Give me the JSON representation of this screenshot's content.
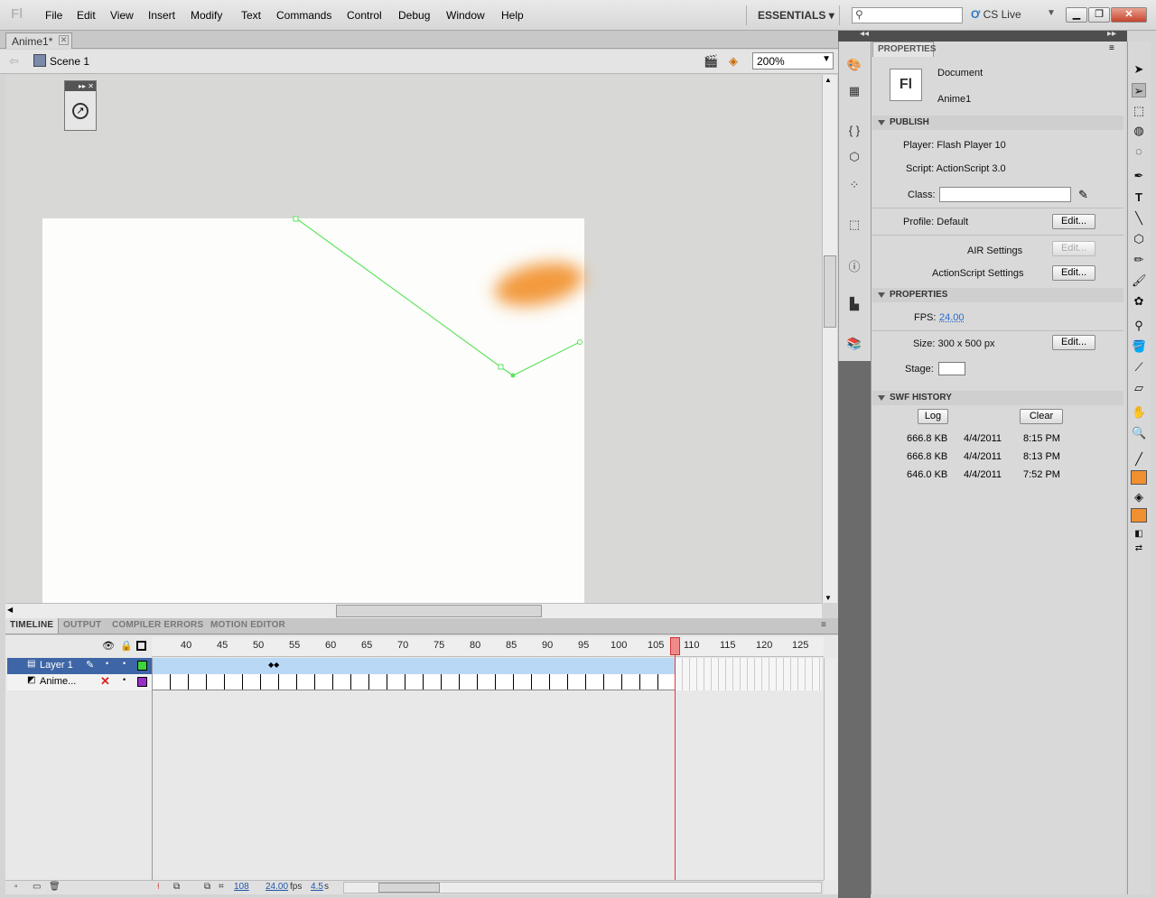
{
  "app": {
    "logo": "Fl"
  },
  "menu": [
    "File",
    "Edit",
    "View",
    "Insert",
    "Modify",
    "Text",
    "Commands",
    "Control",
    "Debug",
    "Window",
    "Help"
  ],
  "workspace": "ESSENTIALS",
  "search": {
    "placeholder": ""
  },
  "cslive": "CS Live",
  "document": {
    "tab": "Anime1*",
    "scene": "Scene 1",
    "zoom": "200%"
  },
  "timeline": {
    "tabs": [
      "TIMELINE",
      "OUTPUT",
      "COMPILER ERRORS",
      "MOTION EDITOR"
    ],
    "ruler": [
      "40",
      "45",
      "50",
      "55",
      "60",
      "65",
      "70",
      "75",
      "80",
      "85",
      "90",
      "95",
      "100",
      "105",
      "110",
      "115",
      "120",
      "125"
    ],
    "layers": [
      {
        "name": "Layer 1"
      },
      {
        "name": "Anime..."
      }
    ],
    "current_frame": "108",
    "fps": "24.00",
    "fps_unit": "fps",
    "elapsed": "4.5",
    "elapsed_unit": "s"
  },
  "properties": {
    "tab": "PROPERTIES",
    "doc_type": "Document",
    "doc_name": "Anime1",
    "publish": {
      "header": "PUBLISH",
      "player": "Player: Flash Player 10",
      "script": "Script: ActionScript 3.0",
      "class_label": "Class:",
      "class_value": "",
      "profile": "Profile: Default",
      "edit": "Edit...",
      "air": "AIR Settings",
      "as_settings": "ActionScript Settings"
    },
    "props": {
      "header": "PROPERTIES",
      "fps_label": "FPS:",
      "fps": "24.00",
      "size": "Size: 300 x 500 px",
      "stage_label": "Stage:",
      "stage_color": "#ffffff"
    },
    "swf_history": {
      "header": "SWF HISTORY",
      "log": "Log",
      "clear": "Clear",
      "rows": [
        {
          "size": "666.8 KB",
          "date": "4/4/2011",
          "time": "8:15 PM"
        },
        {
          "size": "666.8 KB",
          "date": "4/4/2011",
          "time": "8:13 PM"
        },
        {
          "size": "646.0 KB",
          "date": "4/4/2011",
          "time": "7:52 PM"
        }
      ]
    }
  },
  "colors": {
    "stroke": "#f09030",
    "fill": "#f09030",
    "motion_path": "#5fe35f",
    "layer_selected": "#3e66a6"
  }
}
